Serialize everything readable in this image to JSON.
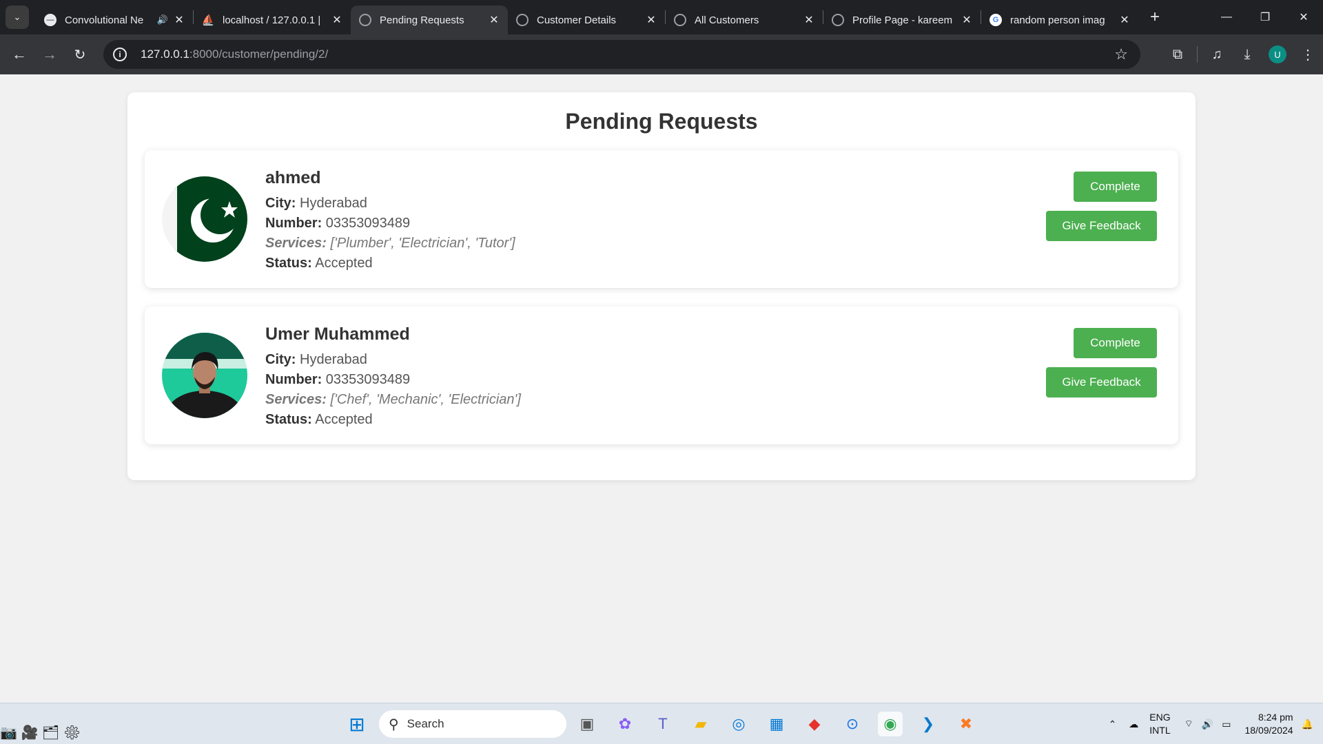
{
  "browser": {
    "tabs": [
      {
        "title": "Convolutional Ne",
        "favicon": "tab-favicon-icon",
        "audio": true,
        "active": false
      },
      {
        "title": "localhost / 127.0.0.1 |",
        "favicon": "phpmyadmin-icon",
        "audio": false,
        "active": false
      },
      {
        "title": "Pending Requests",
        "favicon": "globe-icon",
        "audio": false,
        "active": true
      },
      {
        "title": "Customer Details",
        "favicon": "globe-icon",
        "audio": false,
        "active": false
      },
      {
        "title": "All Customers",
        "favicon": "globe-icon",
        "audio": false,
        "active": false
      },
      {
        "title": "Profile Page - kareem",
        "favicon": "globe-icon",
        "audio": false,
        "active": false
      },
      {
        "title": "random person imag",
        "favicon": "google-icon",
        "audio": false,
        "active": false
      }
    ],
    "url_host": "127.0.0.1",
    "url_path": ":8000/customer/pending/2/",
    "profile_initial": "U"
  },
  "page": {
    "title": "Pending Requests",
    "requests": [
      {
        "name": "ahmed",
        "city_label": "City:",
        "city": "Hyderabad",
        "number_label": "Number:",
        "number": "03353093489",
        "services_label": "Services:",
        "services": "['Plumber', 'Electrician', 'Tutor']",
        "status_label": "Status:",
        "status": "Accepted",
        "photo": "pakistan-flag-icon",
        "complete_label": "Complete",
        "feedback_label": "Give Feedback"
      },
      {
        "name": "Umer Muhammed",
        "city_label": "City:",
        "city": "Hyderabad",
        "number_label": "Number:",
        "number": "03353093489",
        "services_label": "Services:",
        "services": "['Chef', 'Mechanic', 'Electrician']",
        "status_label": "Status:",
        "status": "Accepted",
        "photo": "person-photo",
        "complete_label": "Complete",
        "feedback_label": "Give Feedback"
      }
    ]
  },
  "taskbar": {
    "search_placeholder": "Search",
    "lang_top": "ENG",
    "lang_bottom": "INTL",
    "time": "8:24 pm",
    "date": "18/09/2024"
  },
  "colors": {
    "button": "#4caf50",
    "tabbar": "#202124",
    "toolbar": "#35363a",
    "background": "#f1f1f1"
  }
}
